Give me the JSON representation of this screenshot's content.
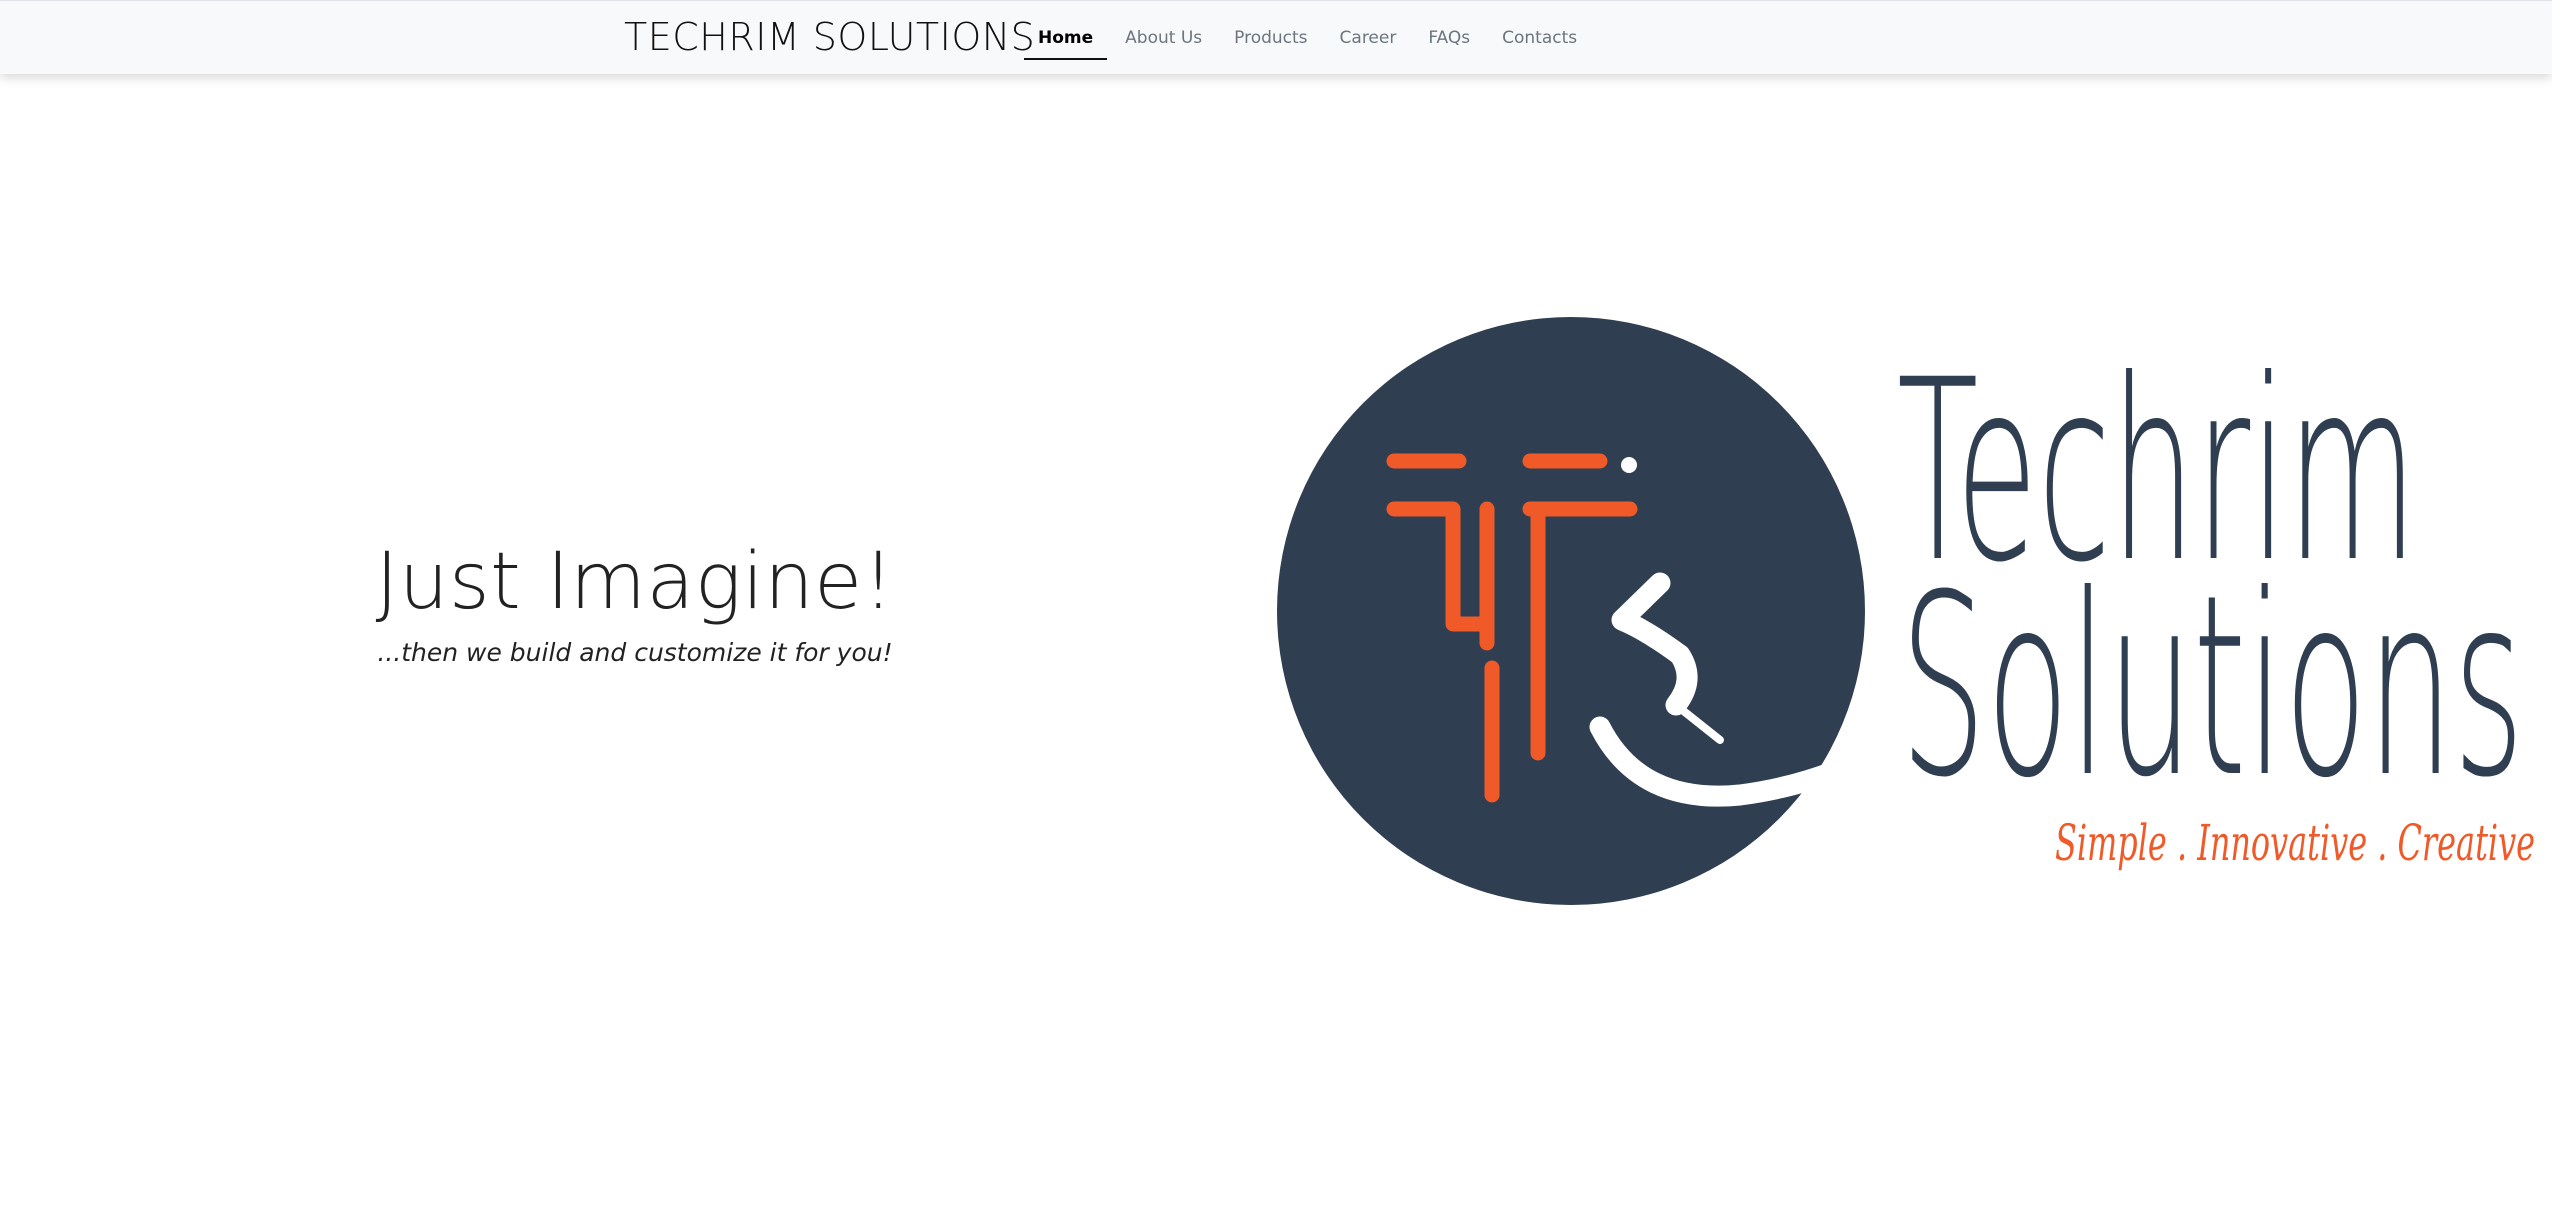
{
  "navbar": {
    "brand": "TECHRIM SOLUTIONS",
    "links": [
      {
        "label": "Home",
        "active": true
      },
      {
        "label": "About Us",
        "active": false
      },
      {
        "label": "Products",
        "active": false
      },
      {
        "label": "Career",
        "active": false
      },
      {
        "label": "FAQs",
        "active": false
      },
      {
        "label": "Contacts",
        "active": false
      }
    ]
  },
  "hero": {
    "title": "Just Imagine!",
    "subtitle": "...then we build and customize it for you!"
  },
  "logo": {
    "name_line1": "Techrim",
    "name_line2": "Solutions",
    "tagline": "Simple . Innovative . Creative",
    "colors": {
      "navy": "#2f3e51",
      "orange": "#f05a28",
      "white": "#ffffff"
    }
  }
}
